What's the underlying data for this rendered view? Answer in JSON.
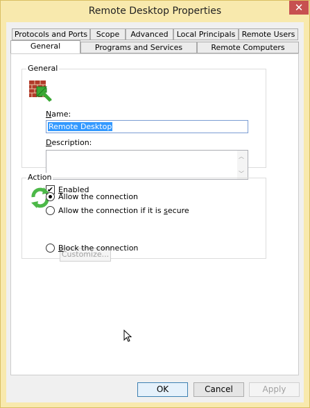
{
  "window": {
    "title": "Remote Desktop Properties",
    "close_glyph": "✕"
  },
  "tabs_row1": [
    {
      "label": "Protocols and Ports"
    },
    {
      "label": "Scope"
    },
    {
      "label": "Advanced"
    },
    {
      "label": "Local Principals"
    },
    {
      "label": "Remote Users"
    }
  ],
  "tabs_row2": [
    {
      "label": "General"
    },
    {
      "label": "Programs and Services"
    },
    {
      "label": "Remote Computers"
    }
  ],
  "general": {
    "group_label": "General",
    "name_label_u": "N",
    "name_label_rest": "ame:",
    "name_value": "Remote Desktop",
    "description_label_u": "D",
    "description_label_rest": "escription:",
    "description_value": "",
    "enabled_label_u": "E",
    "enabled_label_rest": "nabled",
    "enabled_checked": true,
    "icon": "firewall-brick-icon"
  },
  "action": {
    "group_label": "Action",
    "icon": "refresh-arrows-icon",
    "options": [
      {
        "label": "Allow the connection",
        "selected": true
      },
      {
        "label_pre": "Allow the connection if it is ",
        "label_u": "s",
        "label_post": "ecure",
        "selected": false
      },
      {
        "label_u": "B",
        "label_post": "lock the connection",
        "selected": false
      }
    ],
    "customize_label": "Customize..."
  },
  "buttons": {
    "ok": "OK",
    "cancel": "Cancel",
    "apply": "Apply"
  }
}
